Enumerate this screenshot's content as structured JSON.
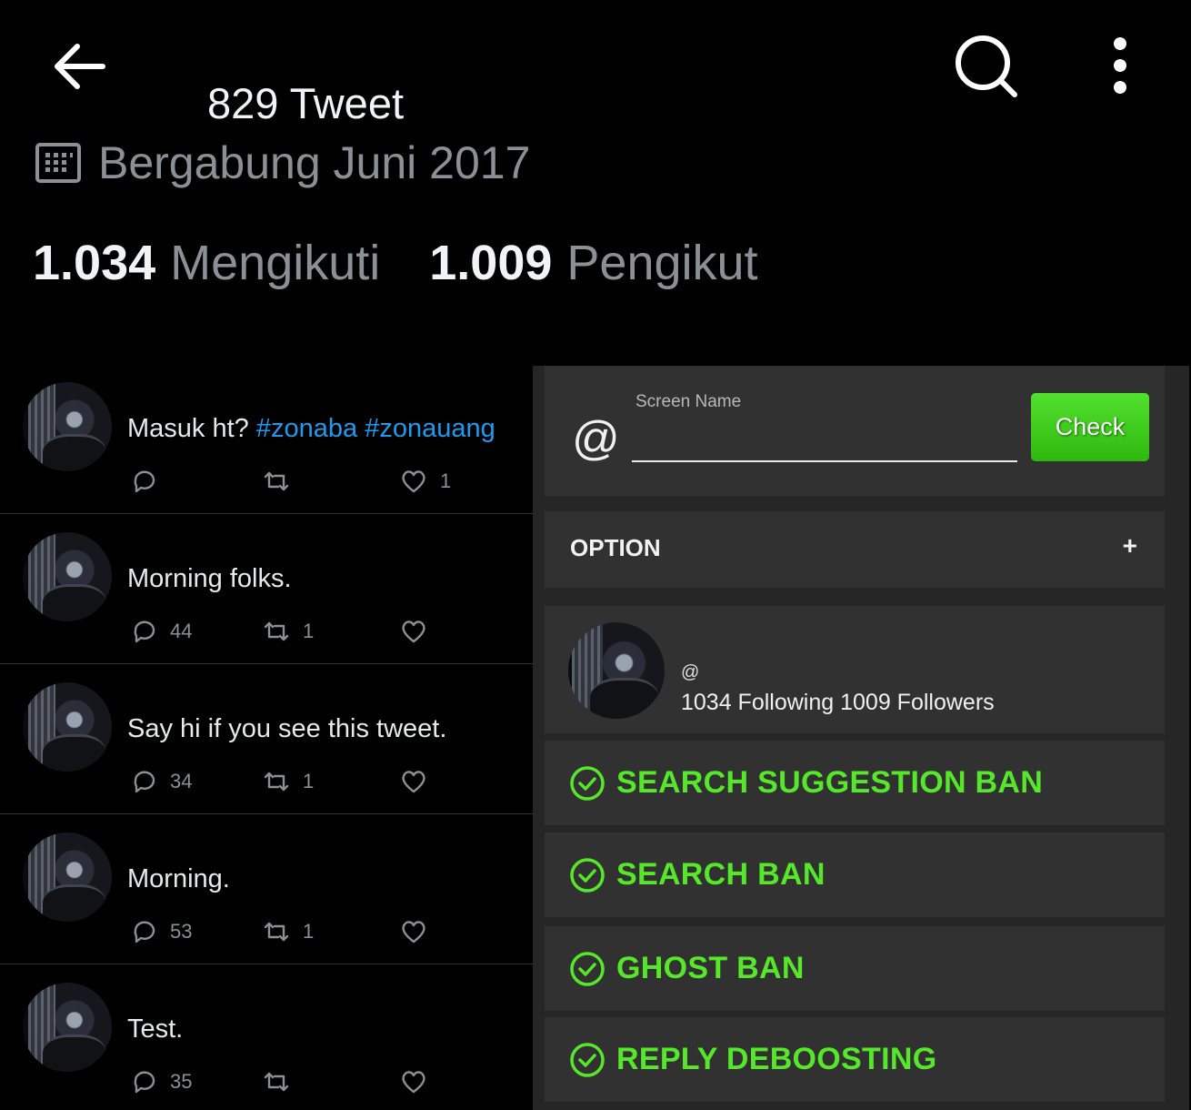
{
  "header": {
    "tweet_count": "829 Tweet",
    "joined": "Bergabung Juni 2017",
    "following_count": "1.034",
    "following_label": "Mengikuti",
    "followers_count": "1.009",
    "followers_label": "Pengikut",
    "icons": [
      "back-arrow-icon",
      "search-icon",
      "more-vertical-icon",
      "calendar-icon"
    ]
  },
  "tweets": [
    {
      "text": "Masuk ht? ",
      "hashtags": [
        "#zonaba",
        "#zonauang"
      ],
      "replies": "",
      "retweets": "",
      "likes": "1"
    },
    {
      "text": "Morning folks.",
      "hashtags": [],
      "replies": "44",
      "retweets": "1",
      "likes": ""
    },
    {
      "text": "Say hi if you see this tweet.",
      "hashtags": [],
      "replies": "34",
      "retweets": "1",
      "likes": ""
    },
    {
      "text": "Morning.",
      "hashtags": [],
      "replies": "53",
      "retweets": "1",
      "likes": ""
    },
    {
      "text": "Test.",
      "hashtags": [],
      "replies": "35",
      "retweets": "",
      "likes": ""
    }
  ],
  "checker": {
    "at_sign": "@",
    "screen_name_label": "Screen Name",
    "screen_name_value": "",
    "check_button": "Check",
    "option_title": "OPTION",
    "option_toggle": "+",
    "profile_handle": "@",
    "profile_stats": "1034 Following 1009 Followers",
    "results": [
      {
        "label": "SEARCH SUGGESTION BAN",
        "status": "passed"
      },
      {
        "label": "SEARCH BAN",
        "status": "passed"
      },
      {
        "label": "GHOST BAN",
        "status": "passed"
      },
      {
        "label": "REPLY DEBOOSTING",
        "status": "passed"
      }
    ]
  },
  "colors": {
    "background": "#000000",
    "hashtag": "#1d9bf0",
    "muted_text": "#8b9096",
    "panel_bg": "#262626",
    "card_bg": "#313131",
    "check_green": "#3cc81c",
    "result_green": "#56e62a"
  }
}
